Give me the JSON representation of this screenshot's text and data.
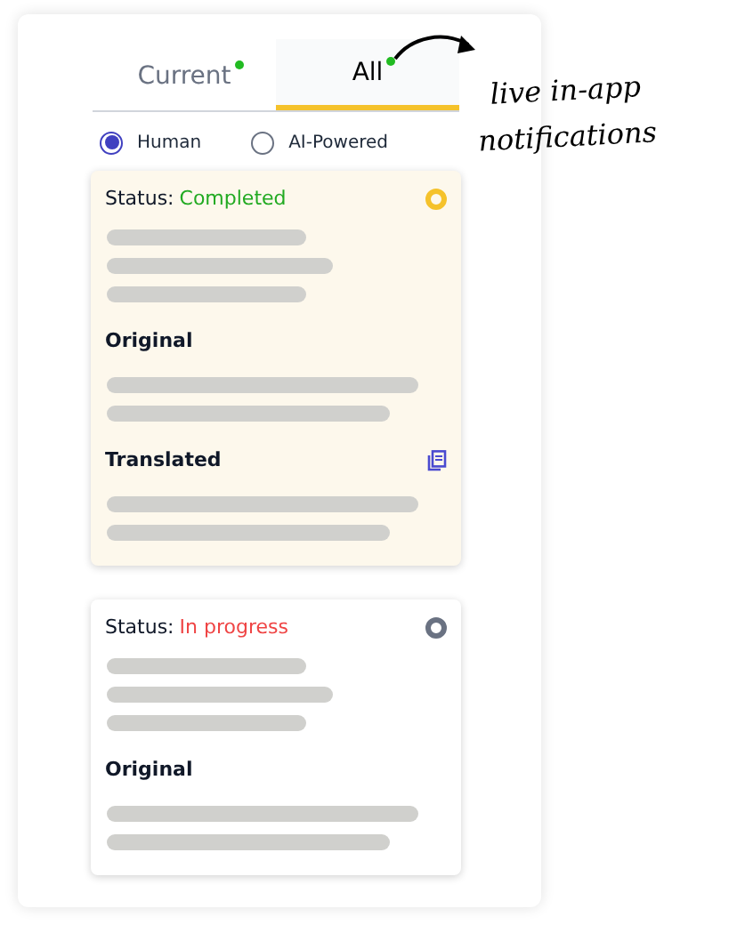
{
  "tabs": [
    {
      "label": "Current",
      "selected": false,
      "dot": true
    },
    {
      "label": "All",
      "selected": true,
      "dot": true
    }
  ],
  "mode_options": [
    {
      "label": "Human",
      "selected": true
    },
    {
      "label": "AI-Powered",
      "selected": false
    }
  ],
  "annotation": {
    "lines": [
      "live in-app",
      "notifications"
    ]
  },
  "cards": [
    {
      "status_label": "Status:",
      "status": "Completed",
      "color": "#22aa22",
      "highlighted": true,
      "sections": [
        {
          "title": "Original",
          "copy_icon": false
        },
        {
          "title": "Translated",
          "copy_icon": true
        }
      ]
    },
    {
      "status_label": "Status:",
      "status": "In progress",
      "color": "#ef4444",
      "highlighted": false,
      "sections": [
        {
          "title": "Original",
          "copy_icon": false
        }
      ]
    }
  ]
}
